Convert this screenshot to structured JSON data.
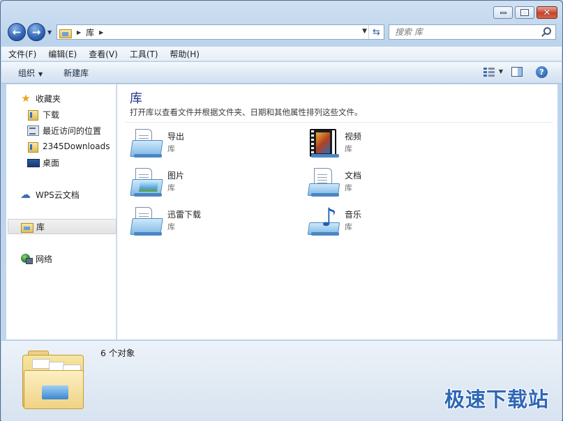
{
  "address": {
    "path": [
      "库"
    ]
  },
  "search": {
    "placeholder": "搜索 库"
  },
  "menu": [
    "文件(F)",
    "编辑(E)",
    "查看(V)",
    "工具(T)",
    "帮助(H)"
  ],
  "toolbar": {
    "organize": "组织",
    "new_library": "新建库"
  },
  "sidebar": {
    "favorites": "收藏夹",
    "favorites_items": [
      "下载",
      "最近访问的位置",
      "2345Downloads",
      "桌面"
    ],
    "wps": "WPS云文档",
    "libraries": "库",
    "network": "网络"
  },
  "main": {
    "heading": "库",
    "description": "打开库以查看文件并根据文件夹、日期和其他属性排列这些文件。",
    "items": [
      {
        "name": "导出",
        "type": "库",
        "icon": "document-library-icon"
      },
      {
        "name": "视频",
        "type": "库",
        "icon": "video-library-icon"
      },
      {
        "name": "图片",
        "type": "库",
        "icon": "pictures-library-icon"
      },
      {
        "name": "文档",
        "type": "库",
        "icon": "documents-library-icon"
      },
      {
        "name": "迅雷下载",
        "type": "库",
        "icon": "document-library-icon"
      },
      {
        "name": "音乐",
        "type": "库",
        "icon": "music-library-icon"
      }
    ]
  },
  "status": {
    "count": "6 个对象"
  },
  "watermark": "极速下载站"
}
